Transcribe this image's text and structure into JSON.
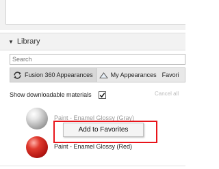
{
  "library": {
    "title": "Library",
    "search": {
      "placeholder": "Search",
      "value": ""
    },
    "tabs": [
      {
        "label": "Fusion 360 Appearances",
        "icon": "refresh-icon"
      },
      {
        "label": "My Appearances",
        "icon": "appearance-icon"
      },
      {
        "label": "Favori",
        "icon": ""
      }
    ],
    "show_downloadable_label": "Show downloadable materials",
    "show_downloadable_checked": true,
    "cancel_label": "Cancel all"
  },
  "materials": [
    {
      "label": "Paint - Enamel Glossy (Gray)",
      "color": "#b0b0b0"
    },
    {
      "label": "Paint - Enamel Glossy (Red)",
      "color": "#d8261c"
    }
  ],
  "context_menu": {
    "item_label": "Add to Favorites"
  },
  "colors": {
    "highlight": "#e8141a"
  }
}
